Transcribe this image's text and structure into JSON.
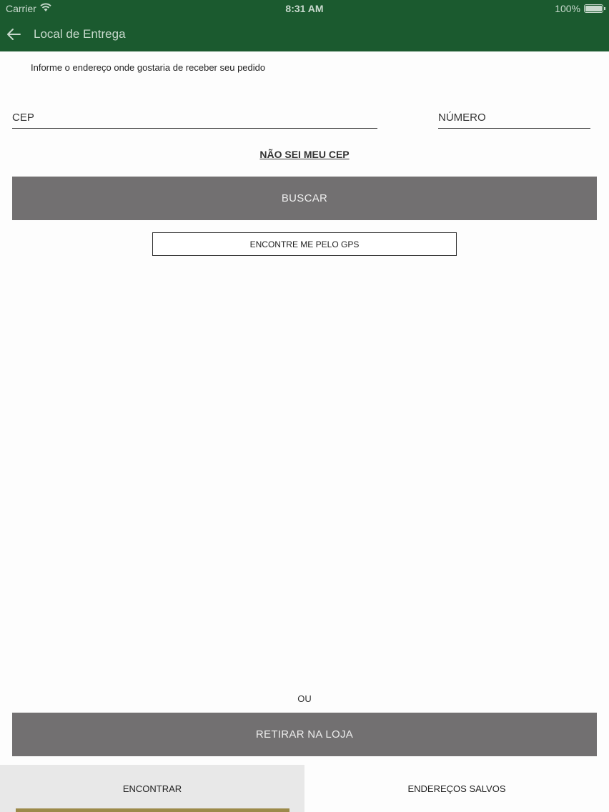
{
  "status_bar": {
    "carrier": "Carrier",
    "time": "8:31 AM",
    "battery": "100%"
  },
  "nav": {
    "title": "Local de Entrega",
    "back_icon": "arrow-left-icon"
  },
  "form": {
    "instruction": "Informe o endereço onde gostaria de receber seu pedido",
    "cep_placeholder": "CEP",
    "numero_placeholder": "NÚMERO",
    "cep_value": "",
    "numero_value": "",
    "unknown_cep_link": "NÃO SEI MEU CEP",
    "search_button": "BUSCAR",
    "gps_button": "ENCONTRE ME PELO GPS"
  },
  "pickup": {
    "separator": "OU",
    "pickup_button": "RETIRAR NA LOJA"
  },
  "tabs": [
    {
      "label": "ENCONTRAR",
      "active": true
    },
    {
      "label": "ENDEREÇOS SALVOS",
      "active": false
    }
  ],
  "colors": {
    "header": "#1b5a2f",
    "button_gray": "#727071",
    "tab_indicator": "#9c8a4a",
    "active_tab_bg": "#e8e8e8"
  }
}
